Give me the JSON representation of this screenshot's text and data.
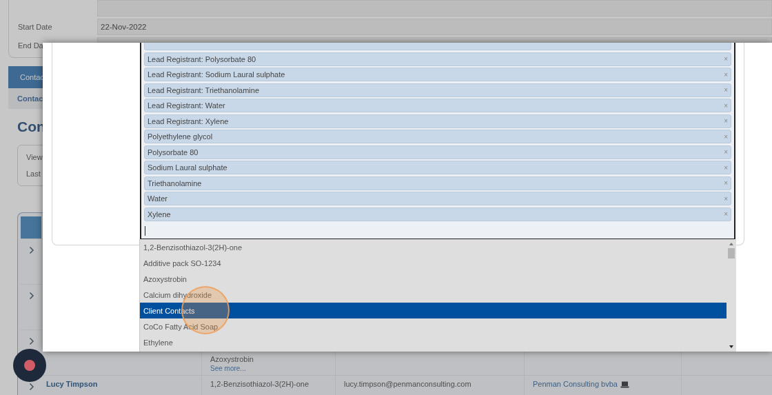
{
  "background": {
    "form": {
      "fields": [
        {
          "label": "Start Date",
          "value": "22-Nov-2022"
        },
        {
          "label": "End Da"
        }
      ]
    },
    "tab": {
      "label": "Contac",
      "selected": true
    },
    "subtab": "Contac",
    "heading": "Con",
    "info": [
      "View",
      "Last"
    ],
    "rows": [
      {
        "expanded": false
      },
      {
        "expanded": false
      },
      {
        "expanded": false,
        "substances": [
          "Azoxystrobin"
        ],
        "see_more": "See more..."
      },
      {
        "expanded": false,
        "name": "Lucy Timpson",
        "substances": [
          "1,2-Benzisothiazol-3(2H)-one"
        ],
        "email": "lucy.timpson@penmanconsulting.com",
        "company": "Penman Consulting bvba"
      }
    ]
  },
  "modal": {
    "tags": [
      {
        "label": "Lead Registrant: Polysorbate 80",
        "remove": "×"
      },
      {
        "label": "Lead Registrant: Sodium Laural sulphate",
        "remove": "×"
      },
      {
        "label": "Lead Registrant: Triethanolamine",
        "remove": "×"
      },
      {
        "label": "Lead Registrant: Water",
        "remove": "×"
      },
      {
        "label": "Lead Registrant: Xylene",
        "remove": "×"
      },
      {
        "label": "Polyethylene glycol",
        "remove": "×"
      },
      {
        "label": "Polysorbate 80",
        "remove": "×"
      },
      {
        "label": "Sodium Laural sulphate",
        "remove": "×"
      },
      {
        "label": "Triethanolamine",
        "remove": "×"
      },
      {
        "label": "Water",
        "remove": "×"
      },
      {
        "label": "Xylene",
        "remove": "×"
      }
    ],
    "options": [
      {
        "label": "1,2-Benzisothiazol-3(2H)-one",
        "selected": false
      },
      {
        "label": "Additive pack SO-1234",
        "selected": false
      },
      {
        "label": "Azoxystrobin",
        "selected": false
      },
      {
        "label": "Calcium dihydroxide",
        "selected": false
      },
      {
        "label": "Client Contacts",
        "selected": true
      },
      {
        "label": "CoCo Fatty Acid Soap",
        "selected": false
      },
      {
        "label": "Ethylene",
        "selected": false
      }
    ]
  }
}
